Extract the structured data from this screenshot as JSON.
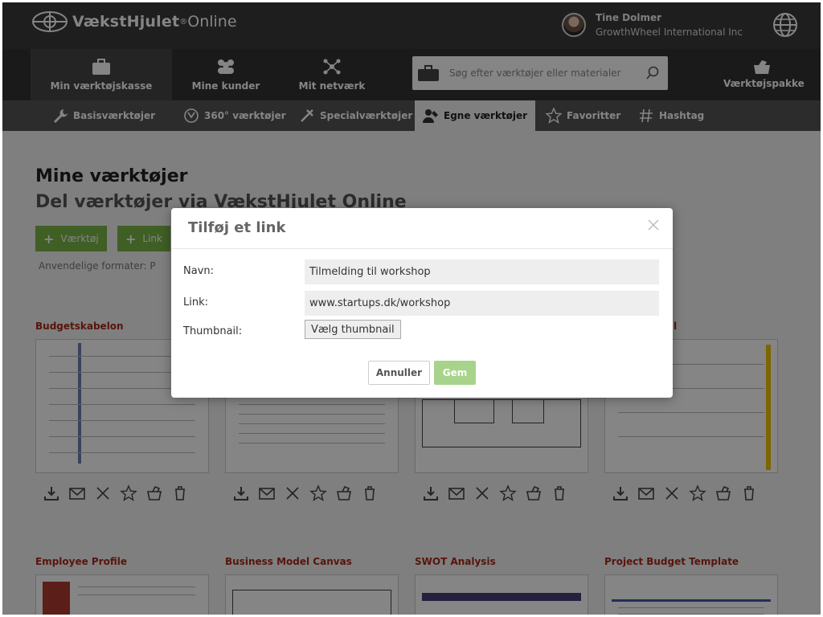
{
  "app": {
    "brand": "VækstHjulet",
    "brand_reg": "®",
    "brand_suffix": "Online"
  },
  "user": {
    "name": "Tine Dolmer",
    "organization": "GrowthWheel International Inc"
  },
  "nav": {
    "items": [
      {
        "label": "Min værktøjskasse",
        "icon": "toolbox-icon",
        "active": true
      },
      {
        "label": "Mine kunder",
        "icon": "clients-icon",
        "active": false
      },
      {
        "label": "Mit netværk",
        "icon": "network-icon",
        "active": false
      }
    ],
    "search_placeholder": "Søg efter værktøjer eller materialer",
    "package_label": "Værktøjspakke"
  },
  "subnav": {
    "items": [
      {
        "label": "Basisværktøjer",
        "icon": "wrench-icon"
      },
      {
        "label": "360° værktøjer",
        "icon": "360-icon"
      },
      {
        "label": "Specialværktøjer",
        "icon": "special-tools-icon"
      },
      {
        "label": "Egne værktøjer",
        "icon": "own-tools-icon",
        "active": true
      },
      {
        "label": "Favoritter",
        "icon": "star-icon"
      },
      {
        "label": "Hashtag",
        "icon": "hashtag-icon"
      }
    ]
  },
  "page": {
    "title": "Mine værktøjer",
    "subtitle": "Del værktøjer via VækstHjulet Online",
    "add_tool_label": "Værktøj",
    "add_link_label": "Link",
    "formats_text": "Anvendelige formater: P"
  },
  "cards_row1": [
    {
      "title": "Budgetskabelon"
    },
    {
      "title": ""
    },
    {
      "title": ""
    },
    {
      "title": "l"
    }
  ],
  "cards_row2": [
    {
      "title": "Employee Profile"
    },
    {
      "title": "Business Model Canvas"
    },
    {
      "title": "SWOT Analysis"
    },
    {
      "title": "Project Budget Template"
    }
  ],
  "card_actions": [
    "download-icon",
    "email-icon",
    "expand-icon",
    "star-icon",
    "toolkit-icon",
    "trash-icon"
  ],
  "modal": {
    "title": "Tilføj et link",
    "name_label": "Navn:",
    "name_value": "Tilmelding til workshop",
    "link_label": "Link:",
    "link_value": "www.startups.dk/workshop",
    "thumbnail_label": "Thumbnail:",
    "thumbnail_button": "Vælg thumbnail",
    "cancel_label": "Annuller",
    "save_label": "Gem"
  },
  "colors": {
    "accent_green": "#7ab648",
    "card_title_red": "#a82a1a",
    "topbar": "#3b3b3b"
  }
}
